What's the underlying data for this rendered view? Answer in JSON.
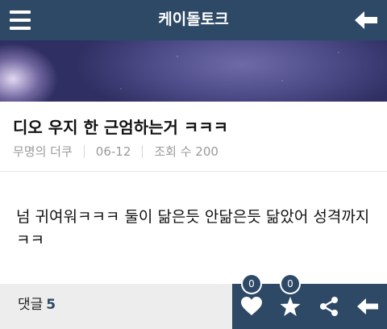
{
  "header": {
    "title": "케이돌토크"
  },
  "post": {
    "title": "디오 우지 한 근엄하는거 ㅋㅋㅋ",
    "author": "무명의 더쿠",
    "date": "06-12",
    "views": "조회 수 200",
    "body": "넘 귀여워ㅋㅋㅋ 둘이 닮은듯 안닮은듯 닮았어 성격까지 ㅋㅋ"
  },
  "footer": {
    "comment_label": "댓글",
    "comment_count": "5",
    "like_count": "0",
    "favorite_count": "0"
  },
  "colors": {
    "header_bg": "#2e4966",
    "footer_bg": "#ededed",
    "accent": "#2e4966"
  }
}
